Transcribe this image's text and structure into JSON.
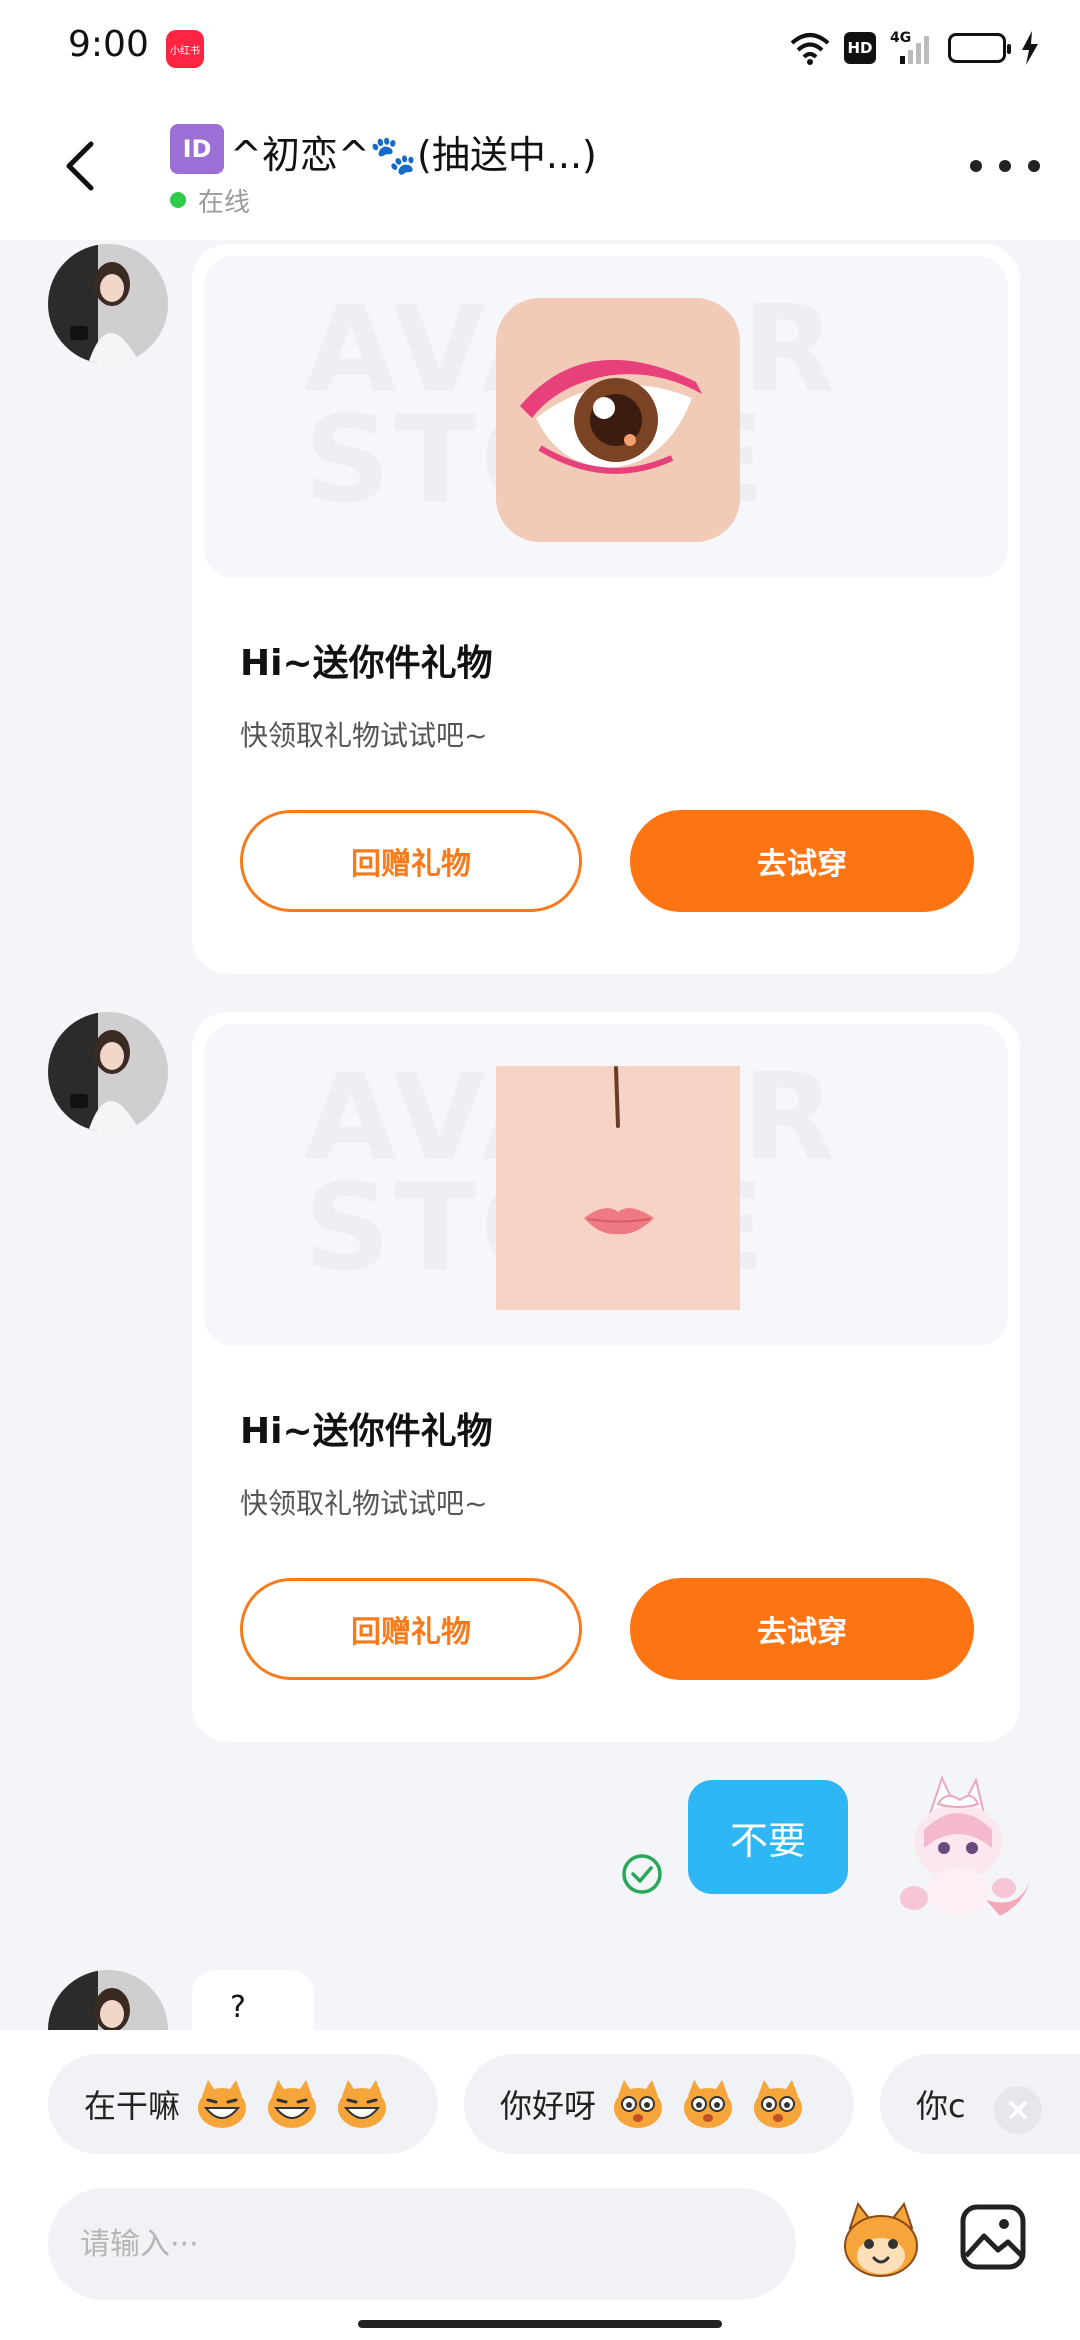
{
  "status_bar": {
    "time": "9:00",
    "app_badge": "小红书",
    "hd": "HD",
    "network": "4G"
  },
  "header": {
    "id_badge": "ID",
    "title": "^初恋^🐾(抽送中...)",
    "status": "在线"
  },
  "messages": [
    {
      "type": "gift",
      "title": "Hi~送你件礼物",
      "subtitle": "快领取礼物试试吧~",
      "watermark": "AVATAR STORE",
      "return_gift_label": "回赠礼物",
      "try_on_label": "去试穿"
    },
    {
      "type": "gift",
      "title": "Hi~送你件礼物",
      "subtitle": "快领取礼物试试吧~",
      "watermark": "AVATAR STORE",
      "return_gift_label": "回赠礼物",
      "try_on_label": "去试穿"
    },
    {
      "type": "sent_text",
      "text": "不要"
    },
    {
      "type": "received_text_partial",
      "text": "?"
    }
  ],
  "quick_replies": [
    {
      "label": "在干嘛"
    },
    {
      "label": "你好呀"
    },
    {
      "label": "你c"
    }
  ],
  "composer": {
    "placeholder": "请输入···"
  },
  "colors": {
    "accent_orange": "#fd7412",
    "sent_bubble_blue": "#2fb6f4",
    "online_green": "#2ecc4a"
  }
}
